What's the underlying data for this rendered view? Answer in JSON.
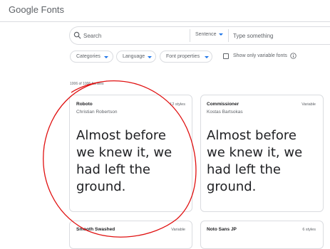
{
  "header": {
    "logo_text": "Google Fonts"
  },
  "search": {
    "placeholder": "Search",
    "preview_mode": "Sentence",
    "preview_placeholder": "Type something"
  },
  "filters": {
    "categories": "Categories",
    "language": "Language",
    "font_properties": "Font properties",
    "variable_only_label": "Show only variable fonts",
    "variable_only_checked": false
  },
  "results": {
    "count_text": "1006 of 1006 families"
  },
  "cards": [
    {
      "name": "Roboto",
      "author": "Christian Robertson",
      "styles": "12 styles",
      "sample": "Almost before we knew it, we had left the ground."
    },
    {
      "name": "Commissioner",
      "author": "Kostas Bartsokas",
      "styles": "Variable",
      "sample": "Almost before we knew it, we had left the ground."
    },
    {
      "name": "Smooth Swashed",
      "styles": "Variable"
    },
    {
      "name": "Noto Sans JP",
      "styles": "6 styles"
    }
  ],
  "colors": {
    "accent": "#1a73e8",
    "annotation": "#e01010",
    "border": "#dadce0"
  }
}
